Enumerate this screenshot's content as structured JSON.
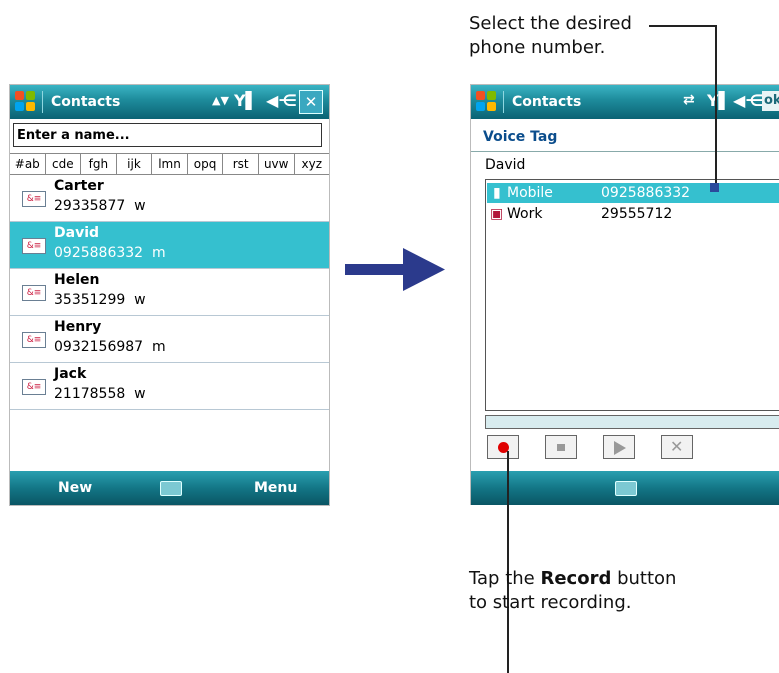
{
  "left_screen": {
    "title": "Contacts",
    "search_placeholder": "Enter a name...",
    "alpha_tabs": [
      "#ab",
      "cde",
      "fgh",
      "ijk",
      "lmn",
      "opq",
      "rst",
      "uvw",
      "xyz"
    ],
    "contacts": [
      {
        "name": "Carter",
        "number": "29335877",
        "type": "w"
      },
      {
        "name": "David",
        "number": "0925886332",
        "type": "m",
        "selected": true
      },
      {
        "name": "Helen",
        "number": "35351299",
        "type": "w"
      },
      {
        "name": "Henry",
        "number": "0932156987",
        "type": "m"
      },
      {
        "name": "Jack",
        "number": "21178558",
        "type": "w"
      }
    ],
    "softkeys": {
      "left": "New",
      "right": "Menu"
    }
  },
  "right_screen": {
    "title": "Contacts",
    "ok_label": "ok",
    "section_title": "Voice Tag",
    "contact_name": "David",
    "numbers": [
      {
        "label": "Mobile",
        "number": "0925886332",
        "selected": true
      },
      {
        "label": "Work",
        "number": "29555712"
      }
    ]
  },
  "annotations": {
    "top_line1": "Select the desired",
    "top_line2": "phone number.",
    "bottom_line1_pre": "Tap the ",
    "bottom_line1_bold": "Record",
    "bottom_line1_post": " button",
    "bottom_line2": "to start recording."
  },
  "colors": {
    "titlebar": "#1d8a9a",
    "selection": "#35c0cf",
    "voice_tag_title": "#0b4d8c",
    "arrow": "#2b3a8c",
    "record_dot": "#e00000"
  }
}
